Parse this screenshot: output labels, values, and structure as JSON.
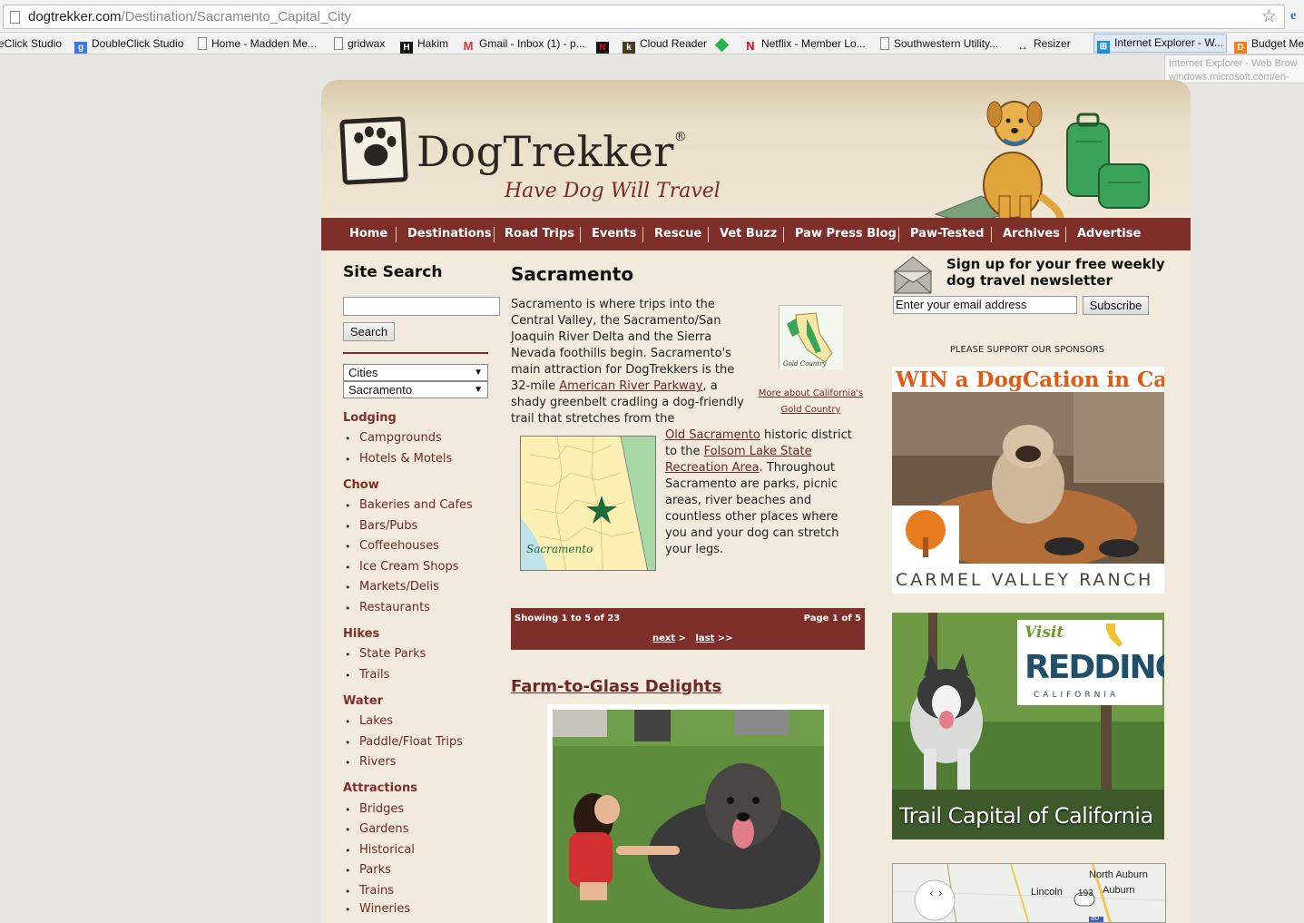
{
  "browser": {
    "url_host": "dogtrekker.com",
    "url_path": "/Destination/Sacramento_Capital_City",
    "bookmarks": [
      {
        "label": "eClick Studio",
        "icon": "doubleclick-icon"
      },
      {
        "label": "DoubleClick Studio",
        "icon": "google-icon"
      },
      {
        "label": "Home - Madden Me...",
        "icon": "page-icon"
      },
      {
        "label": "gridwax",
        "icon": "page-icon"
      },
      {
        "label": "Hakim",
        "icon": "h-icon"
      },
      {
        "label": "Gmail - Inbox (1) - p...",
        "icon": "gmail-icon"
      },
      {
        "label": "",
        "icon": "netflix-n-icon"
      },
      {
        "label": "Cloud Reader",
        "icon": "kindle-icon"
      },
      {
        "label": "",
        "icon": "feedly-icon"
      },
      {
        "label": "Netflix - Member Lo...",
        "icon": "netflix-icon"
      },
      {
        "label": "Southwestern Utility...",
        "icon": "page-icon"
      },
      {
        "label": "Resizer",
        "icon": "resizer-icon"
      },
      {
        "label": "Internet Explorer - W...",
        "icon": "windows-icon"
      },
      {
        "label": "Budget Me",
        "icon": "budget-icon"
      }
    ],
    "tooltip_line1": "Internet Explorer - Web Brow",
    "tooltip_line2": "windows.microsoft.com/en-"
  },
  "header": {
    "brand": "DogTrekker",
    "reg": "®",
    "tagline": "Have Dog Will Travel"
  },
  "nav": [
    "Home",
    "Destinations",
    "Road Trips",
    "Events",
    "Rescue",
    "Vet Buzz",
    "Paw Press Blog",
    "Paw-Tested",
    "Archives",
    "Advertise"
  ],
  "sidebar": {
    "search_title": "Site Search",
    "search_button": "Search",
    "select_type": "Cities",
    "select_city": "Sacramento",
    "categories": [
      {
        "title": "Lodging",
        "items": [
          "Campgrounds",
          "Hotels & Motels"
        ]
      },
      {
        "title": "Chow",
        "items": [
          "Bakeries and Cafes",
          "Bars/Pubs",
          "Coffeehouses",
          "Ice Cream Shops",
          "Markets/Delis",
          "Restaurants"
        ]
      },
      {
        "title": "Hikes",
        "items": [
          "State Parks",
          "Trails"
        ]
      },
      {
        "title": "Water",
        "items": [
          "Lakes",
          "Paddle/Float Trips",
          "Rivers"
        ]
      },
      {
        "title": "Attractions",
        "items": [
          "Bridges",
          "Gardens",
          "Historical",
          "Parks",
          "Trains",
          "Wineries"
        ]
      }
    ]
  },
  "main": {
    "title": "Sacramento",
    "intro_l1": "Sacramento is where trips into the",
    "intro_l2": "Central Valley, the Sacramento/San",
    "intro_l3": "Joaquin River Delta and the Sierra",
    "intro_l4": "Nevada foothills begin. Sacramento's",
    "intro_l5": "main attraction for DogTrekkers is the",
    "intro_l6a": "32-mile ",
    "intro_l6link": "American River Parkway",
    "intro_l6b": ", a",
    "intro_l7": "shady greenbelt cradling a dog-friendly",
    "intro_l8": "trail that stretches from the",
    "wrap_l1link": "Old Sacramento",
    "wrap_l1b": " historic district",
    "wrap_l2a": "to the ",
    "wrap_l2link": "Folsom Lake State",
    "wrap_l3link": "Recreation Area",
    "wrap_l3b": ". Throughout",
    "wrap_l4": "Sacramento are parks, picnic",
    "wrap_l5": "areas, river beaches and",
    "wrap_l6": "countless other places where",
    "wrap_l7": "you and your dog can stretch",
    "wrap_l8": "your legs.",
    "gold_caption_l1": "More about California's",
    "gold_caption_l2": "Gold Country",
    "gold_thumb_label": "Gold Country",
    "map_label": "Sacramento",
    "pager": {
      "showing": "Showing 1 to 5 of 23",
      "page": "Page 1 of 5",
      "next": "next",
      "next_arrow": " > ",
      "last": "last",
      "last_arrow": " >>"
    },
    "article_title": "Farm-to-Glass Delights"
  },
  "right": {
    "newsletter_l1": "Sign up for your free weekly",
    "newsletter_l2": "dog travel newsletter",
    "email_placeholder": "Enter your email address",
    "subscribe": "Subscribe",
    "sponsors": "PLEASE SUPPORT OUR SPONSORS",
    "ad1_head": "WIN a DogCation in Carmel!",
    "ad1_foot": "CARMEL VALLEY RANCH",
    "ad2_visit": "Visit",
    "ad2_redding": "REDDING",
    "ad2_ca": "CALIFORNIA",
    "ad2_tag": "Trail Capital of California",
    "map_labels": {
      "north_auburn": "North Auburn",
      "lincoln": "Lincoln",
      "auburn": "Auburn",
      "hwy193": "193",
      "hwy80": "80"
    }
  },
  "colors": {
    "nav": "#7f2f2a",
    "link": "#6b2a25",
    "page_bg": "#f2ebdd"
  }
}
